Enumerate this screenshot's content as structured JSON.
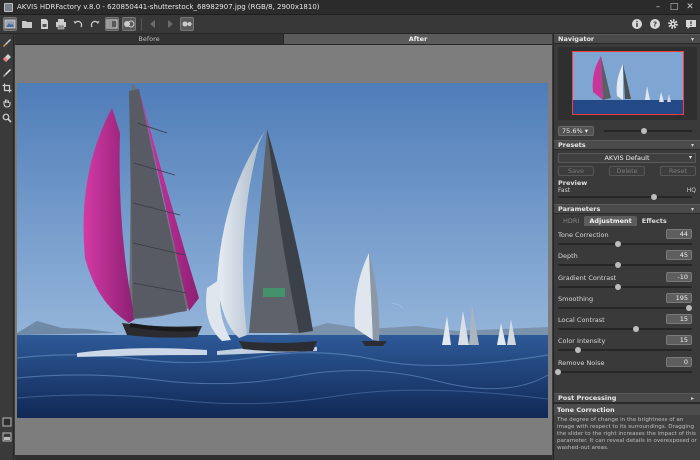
{
  "window": {
    "title": "AKVIS HDRFactory v.8.0 - 620850441-shutterstock_68982907.jpg (RGB/8, 2900x1810)",
    "controls": [
      "minimize",
      "maximize",
      "close"
    ]
  },
  "toolbar": {
    "buttons": [
      {
        "name": "open-image",
        "icon": "folder-open-icon"
      },
      {
        "name": "open-folder",
        "icon": "folder-icon"
      },
      {
        "name": "save",
        "icon": "save-icon"
      },
      {
        "name": "print",
        "icon": "print-icon"
      },
      {
        "name": "undo",
        "icon": "undo-icon"
      },
      {
        "name": "redo",
        "icon": "redo-icon"
      },
      {
        "name": "before-after",
        "icon": "compare-icon"
      },
      {
        "name": "settings-hdr",
        "icon": "hdr-icon"
      }
    ],
    "right_buttons": [
      "info-icon",
      "help-icon",
      "gear-icon",
      "notification-icon"
    ]
  },
  "tools": [
    "brush-icon",
    "eraser-icon",
    "history-brush-icon",
    "crop-icon",
    "hand-icon",
    "zoom-icon"
  ],
  "view_tabs": {
    "before": "Before",
    "after": "After",
    "active": "after"
  },
  "navigator": {
    "title": "Navigator",
    "zoom": "75.6%",
    "zoom_slider": 0.45
  },
  "presets": {
    "title": "Presets",
    "selected": "AKVIS Default",
    "save": "Save",
    "delete": "Delete",
    "reset": "Reset",
    "preview_label": "Preview",
    "preview_fast": "Fast",
    "preview_hq": "HQ",
    "preview_value": 0.72
  },
  "parameters": {
    "title": "Parameters",
    "tabs": [
      "HDRI",
      "Adjustment",
      "Effects"
    ],
    "active_tab": "Adjustment",
    "items": [
      {
        "label": "Tone Correction",
        "value": "44",
        "level": 0.45
      },
      {
        "label": "Depth",
        "value": "45",
        "level": 0.45
      },
      {
        "label": "Gradient Contrast",
        "value": "-10",
        "level": 0.45
      },
      {
        "label": "Smoothing",
        "value": "195",
        "level": 0.98
      },
      {
        "label": "Local Contrast",
        "value": "15",
        "level": 0.58
      },
      {
        "label": "Color Intensity",
        "value": "15",
        "level": 0.15
      },
      {
        "label": "Remove Noise",
        "value": "0",
        "level": 0.0
      }
    ]
  },
  "post_processing": {
    "title": "Post Processing"
  },
  "tip": {
    "title": "Tone Correction",
    "text": "The degree of change in the brightness of an image with respect to its surroundings. Dragging the slider to the right increases the impact of this parameter. It can reveal details in overexposed or washed-out areas."
  },
  "colors": {
    "accent_magenta": "#c22d8f",
    "sky": "#6f98c8",
    "sea": "#1c3c78"
  }
}
